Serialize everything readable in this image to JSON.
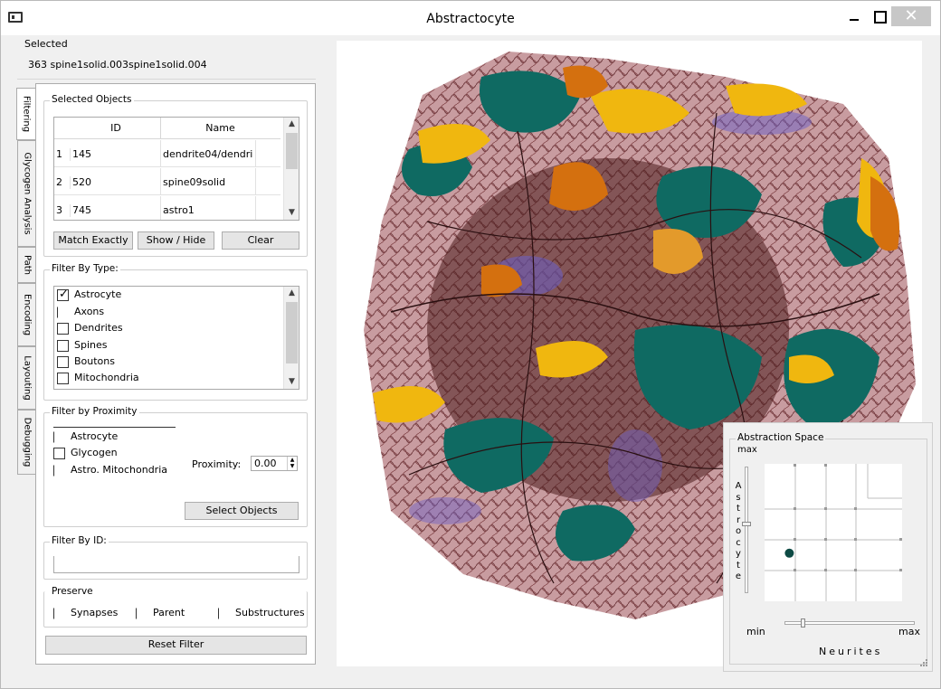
{
  "window": {
    "title": "Abstractocyte",
    "close_symbol": "✕"
  },
  "selected": {
    "label": "Selected",
    "value": "363  spine1solid.003spine1solid.004"
  },
  "tabs": [
    {
      "label": "Filtering",
      "active": true
    },
    {
      "label": "Glycogen Analysis",
      "active": false
    },
    {
      "label": "Path",
      "active": false
    },
    {
      "label": "Encoding",
      "active": false
    },
    {
      "label": "Layouting",
      "active": false
    },
    {
      "label": "Debugging",
      "active": false
    }
  ],
  "selected_objects": {
    "title": "Selected Objects",
    "columns": [
      "ID",
      "Name"
    ],
    "rows": [
      {
        "num": "1",
        "id": "145",
        "name": "dendrite04/dendri"
      },
      {
        "num": "2",
        "id": "520",
        "name": "spine09solid"
      },
      {
        "num": "3",
        "id": "745",
        "name": "astro1"
      }
    ],
    "buttons": {
      "match": "Match Exactly",
      "show_hide": "Show / Hide",
      "clear": "Clear"
    }
  },
  "filter_type": {
    "title": "Filter By Type:",
    "items": [
      {
        "label": "Astrocyte",
        "checked": true
      },
      {
        "label": "Axons",
        "checked": false
      },
      {
        "label": "Dendrites",
        "checked": false
      },
      {
        "label": "Spines",
        "checked": false
      },
      {
        "label": "Boutons",
        "checked": false
      },
      {
        "label": "Mitochondria",
        "checked": false
      }
    ]
  },
  "filter_proximity": {
    "title": "Filter by Proximity",
    "items": [
      {
        "label": "Astrocyte",
        "checked": false
      },
      {
        "label": "Glycogen",
        "checked": false
      },
      {
        "label": "Astro. Mitochondria",
        "checked": false
      }
    ],
    "proximity_label": "Proximity:",
    "proximity_value": "0.00",
    "select_button": "Select Objects"
  },
  "filter_id": {
    "title": "Filter By ID:",
    "value": ""
  },
  "preserve": {
    "title": "Preserve",
    "items": [
      {
        "label": "Synapses",
        "checked": false
      },
      {
        "label": "Parent",
        "checked": false
      },
      {
        "label": "Substructures",
        "checked": false
      }
    ]
  },
  "reset_button": "Reset Filter",
  "abstraction_space": {
    "title": "Abstraction Space",
    "y_axis_label": "Astrocyte",
    "x_axis_label": "Neurites",
    "y_max": "max",
    "x_min": "min",
    "x_max": "max",
    "marker_color": "#0d4a44",
    "marker_position": {
      "neurites": 0.18,
      "astrocyte": 0.35
    },
    "astrocyte_slider_level": 0.45,
    "neurites_slider_level": 0.12
  },
  "colors": {
    "teal": "#0f6a62",
    "orange": "#d4700f",
    "yellow": "#f0b70f",
    "maroon": "#8e3a3f",
    "purple": "#6a5fc8"
  }
}
